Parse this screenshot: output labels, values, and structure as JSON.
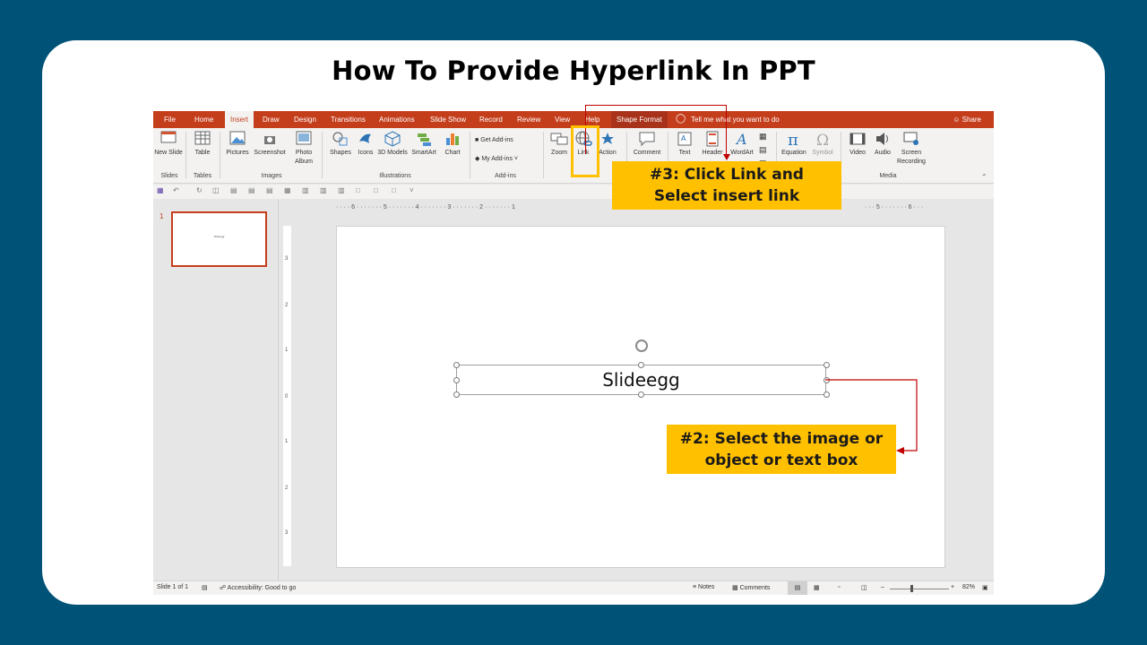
{
  "title": "How To Provide Hyperlink In PPT",
  "tabs": [
    {
      "label": "File",
      "active": false
    },
    {
      "label": "Home",
      "active": false
    },
    {
      "label": "Insert",
      "active": true
    },
    {
      "label": "Draw",
      "active": false
    },
    {
      "label": "Design",
      "active": false
    },
    {
      "label": "Transitions",
      "active": false
    },
    {
      "label": "Animations",
      "active": false
    },
    {
      "label": "Slide Show",
      "active": false
    },
    {
      "label": "Record",
      "active": false
    },
    {
      "label": "Review",
      "active": false
    },
    {
      "label": "View",
      "active": false
    },
    {
      "label": "Help",
      "active": false
    },
    {
      "label": "Shape Format",
      "active": false
    }
  ],
  "tell_me": "Tell me what you want to do",
  "share": "Share",
  "ribbon": {
    "new_slide": "New Slide",
    "table": "Table",
    "pictures": "Pictures",
    "screenshot": "Screenshot",
    "photo_album": "Photo Album",
    "shapes": "Shapes",
    "icons": "Icons",
    "models_3d": "3D Models",
    "smartart": "SmartArt",
    "chart": "Chart",
    "get_addins": "Get Add-ins",
    "my_addins": "My Add-ins",
    "zoom": "Zoom",
    "link": "Link",
    "action": "Action",
    "comment": "Comment",
    "text": "Text",
    "header": "Header",
    "wordart": "WordArt",
    "equation": "Equation",
    "symbol": "Symbol",
    "video": "Video",
    "audio": "Audio",
    "screen_recording": "Screen Recording",
    "groups": {
      "slides": "Slides",
      "tables": "Tables",
      "images": "Images",
      "illustrations": "Illustrations",
      "addins": "Add-ins",
      "media": "Media"
    }
  },
  "thumbnail": {
    "number": "1",
    "text": "Slideegg"
  },
  "slide": {
    "textbox": "Slideegg"
  },
  "status": {
    "slide_info": "Slide 1 of 1",
    "accessibility": "Accessibility: Good to go",
    "notes": "Notes",
    "comments": "Comments",
    "zoom": "82%"
  },
  "callouts": {
    "step3": [
      "#3: Click Link and",
      "Select insert link"
    ],
    "step2": [
      "#2: Select the image or",
      "object or text box"
    ]
  },
  "colors": {
    "background": "#005377",
    "accent": "#c43e1c",
    "callout": "#ffc000",
    "arrow": "#c00000"
  }
}
